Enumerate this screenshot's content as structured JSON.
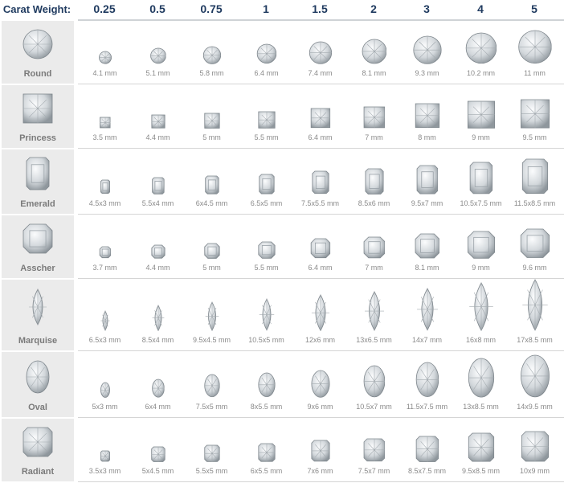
{
  "header": {
    "label": "Carat Weight:",
    "carats": [
      "0.25",
      "0.5",
      "0.75",
      "1",
      "1.5",
      "2",
      "3",
      "4",
      "5"
    ]
  },
  "rows": [
    {
      "shape": "Round",
      "sizes": [
        "4.1 mm",
        "5.1 mm",
        "5.8 mm",
        "6.4 mm",
        "7.4 mm",
        "8.1 mm",
        "9.3 mm",
        "10.2 mm",
        "11 mm"
      ]
    },
    {
      "shape": "Princess",
      "sizes": [
        "3.5 mm",
        "4.4 mm",
        "5 mm",
        "5.5 mm",
        "6.4 mm",
        "7 mm",
        "8 mm",
        "9 mm",
        "9.5 mm"
      ]
    },
    {
      "shape": "Emerald",
      "sizes": [
        "4.5x3 mm",
        "5.5x4 mm",
        "6x4.5 mm",
        "6.5x5 mm",
        "7.5x5.5 mm",
        "8.5x6 mm",
        "9.5x7 mm",
        "10.5x7.5 mm",
        "11.5x8.5 mm"
      ]
    },
    {
      "shape": "Asscher",
      "sizes": [
        "3.7 mm",
        "4.4 mm",
        "5 mm",
        "5.5 mm",
        "6.4 mm",
        "7 mm",
        "8.1 mm",
        "9 mm",
        "9.6 mm"
      ]
    },
    {
      "shape": "Marquise",
      "sizes": [
        "6.5x3 mm",
        "8.5x4 mm",
        "9.5x4.5 mm",
        "10.5x5 mm",
        "12x6 mm",
        "13x6.5 mm",
        "14x7 mm",
        "16x8 mm",
        "17x8.5 mm"
      ]
    },
    {
      "shape": "Oval",
      "sizes": [
        "5x3 mm",
        "6x4 mm",
        "7.5x5 mm",
        "8x5.5 mm",
        "9x6 mm",
        "10.5x7 mm",
        "11.5x7.5 mm",
        "13x8.5 mm",
        "14x9.5 mm"
      ]
    },
    {
      "shape": "Radiant",
      "sizes": [
        "3.5x3 mm",
        "5x4.5 mm",
        "5.5x5 mm",
        "6x5.5 mm",
        "7x6 mm",
        "7.5x7 mm",
        "8.5x7.5 mm",
        "9.5x8.5 mm",
        "10x9 mm"
      ]
    }
  ],
  "colors": {
    "header_text": "#1f3a5f",
    "label_bg": "#ebebeb"
  }
}
